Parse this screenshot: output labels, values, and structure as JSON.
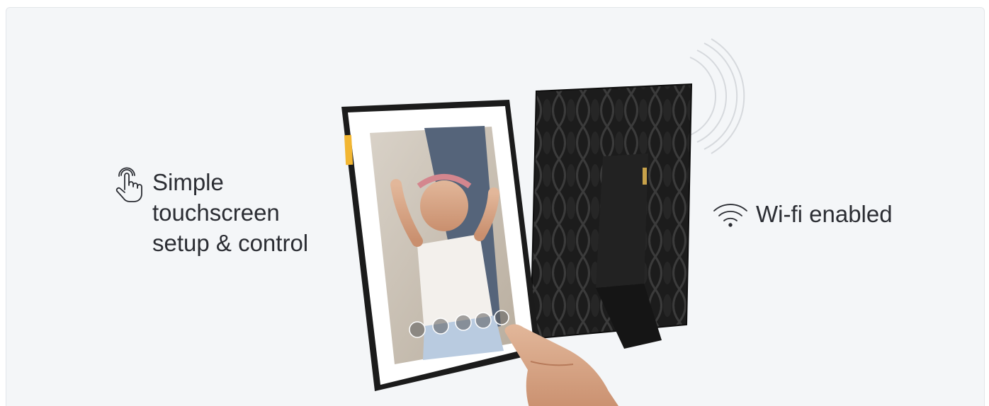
{
  "features": {
    "touch": {
      "icon": "touch-hand-icon",
      "label": "Simple touchscreen setup & control"
    },
    "wifi": {
      "icon": "wifi-icon",
      "label": "Wi-fi enabled"
    }
  },
  "frame_controls": [
    "power-icon",
    "slideshow-icon",
    "settings-icon",
    "pause-icon",
    "heart-icon"
  ],
  "colors": {
    "background": "#f4f6f8",
    "frame": "#1b1b1b",
    "accent": "#f2b632",
    "text": "#2b2d33"
  }
}
